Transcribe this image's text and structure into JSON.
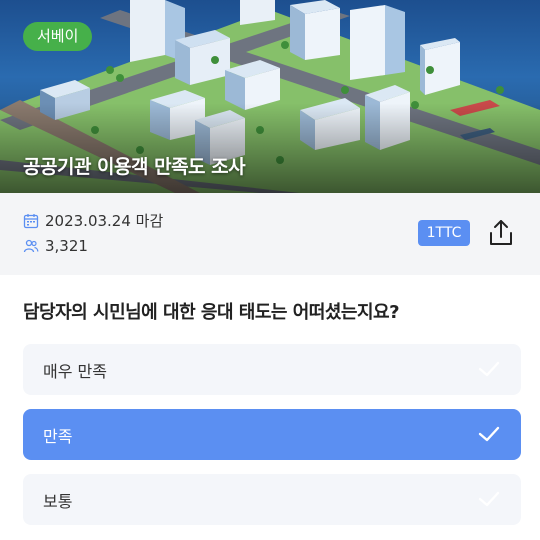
{
  "hero": {
    "tag": "서베이",
    "title": "공공기관 이용객 만족도 조사",
    "image": "isometric-city-illustration"
  },
  "info": {
    "deadline": "2023.03.24 마감",
    "participants": "3,321",
    "badge": "1TTC",
    "icons": [
      "calendar-icon",
      "people-icon",
      "share-icon"
    ]
  },
  "question": "담당자의 시민님에 대한 응대 태도는 어떠셨는지요?",
  "options": [
    {
      "label": "매우 만족",
      "selected": false
    },
    {
      "label": "만족",
      "selected": true
    },
    {
      "label": "보통",
      "selected": false
    }
  ],
  "colors": {
    "tag": "#46b04a",
    "accent": "#5b8ff2",
    "option_bg": "#f4f6fa",
    "info_bg": "#f4f5f7"
  }
}
